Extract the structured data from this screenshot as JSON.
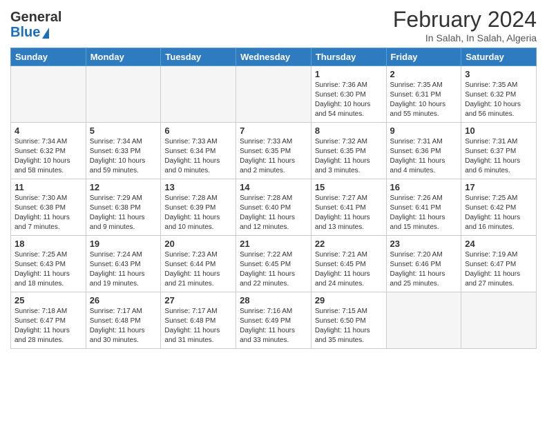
{
  "header": {
    "logo_text_general": "General",
    "logo_text_blue": "Blue",
    "month_title": "February 2024",
    "subtitle": "In Salah, In Salah, Algeria"
  },
  "days_of_week": [
    "Sunday",
    "Monday",
    "Tuesday",
    "Wednesday",
    "Thursday",
    "Friday",
    "Saturday"
  ],
  "weeks": [
    [
      {
        "day": "",
        "empty": true
      },
      {
        "day": "",
        "empty": true
      },
      {
        "day": "",
        "empty": true
      },
      {
        "day": "",
        "empty": true
      },
      {
        "day": "1",
        "sunrise": "7:36 AM",
        "sunset": "6:30 PM",
        "daylight": "10 hours and 54 minutes."
      },
      {
        "day": "2",
        "sunrise": "7:35 AM",
        "sunset": "6:31 PM",
        "daylight": "10 hours and 55 minutes."
      },
      {
        "day": "3",
        "sunrise": "7:35 AM",
        "sunset": "6:32 PM",
        "daylight": "10 hours and 56 minutes."
      }
    ],
    [
      {
        "day": "4",
        "sunrise": "7:34 AM",
        "sunset": "6:32 PM",
        "daylight": "10 hours and 58 minutes."
      },
      {
        "day": "5",
        "sunrise": "7:34 AM",
        "sunset": "6:33 PM",
        "daylight": "10 hours and 59 minutes."
      },
      {
        "day": "6",
        "sunrise": "7:33 AM",
        "sunset": "6:34 PM",
        "daylight": "11 hours and 0 minutes."
      },
      {
        "day": "7",
        "sunrise": "7:33 AM",
        "sunset": "6:35 PM",
        "daylight": "11 hours and 2 minutes."
      },
      {
        "day": "8",
        "sunrise": "7:32 AM",
        "sunset": "6:35 PM",
        "daylight": "11 hours and 3 minutes."
      },
      {
        "day": "9",
        "sunrise": "7:31 AM",
        "sunset": "6:36 PM",
        "daylight": "11 hours and 4 minutes."
      },
      {
        "day": "10",
        "sunrise": "7:31 AM",
        "sunset": "6:37 PM",
        "daylight": "11 hours and 6 minutes."
      }
    ],
    [
      {
        "day": "11",
        "sunrise": "7:30 AM",
        "sunset": "6:38 PM",
        "daylight": "11 hours and 7 minutes."
      },
      {
        "day": "12",
        "sunrise": "7:29 AM",
        "sunset": "6:38 PM",
        "daylight": "11 hours and 9 minutes."
      },
      {
        "day": "13",
        "sunrise": "7:28 AM",
        "sunset": "6:39 PM",
        "daylight": "11 hours and 10 minutes."
      },
      {
        "day": "14",
        "sunrise": "7:28 AM",
        "sunset": "6:40 PM",
        "daylight": "11 hours and 12 minutes."
      },
      {
        "day": "15",
        "sunrise": "7:27 AM",
        "sunset": "6:41 PM",
        "daylight": "11 hours and 13 minutes."
      },
      {
        "day": "16",
        "sunrise": "7:26 AM",
        "sunset": "6:41 PM",
        "daylight": "11 hours and 15 minutes."
      },
      {
        "day": "17",
        "sunrise": "7:25 AM",
        "sunset": "6:42 PM",
        "daylight": "11 hours and 16 minutes."
      }
    ],
    [
      {
        "day": "18",
        "sunrise": "7:25 AM",
        "sunset": "6:43 PM",
        "daylight": "11 hours and 18 minutes."
      },
      {
        "day": "19",
        "sunrise": "7:24 AM",
        "sunset": "6:43 PM",
        "daylight": "11 hours and 19 minutes."
      },
      {
        "day": "20",
        "sunrise": "7:23 AM",
        "sunset": "6:44 PM",
        "daylight": "11 hours and 21 minutes."
      },
      {
        "day": "21",
        "sunrise": "7:22 AM",
        "sunset": "6:45 PM",
        "daylight": "11 hours and 22 minutes."
      },
      {
        "day": "22",
        "sunrise": "7:21 AM",
        "sunset": "6:45 PM",
        "daylight": "11 hours and 24 minutes."
      },
      {
        "day": "23",
        "sunrise": "7:20 AM",
        "sunset": "6:46 PM",
        "daylight": "11 hours and 25 minutes."
      },
      {
        "day": "24",
        "sunrise": "7:19 AM",
        "sunset": "6:47 PM",
        "daylight": "11 hours and 27 minutes."
      }
    ],
    [
      {
        "day": "25",
        "sunrise": "7:18 AM",
        "sunset": "6:47 PM",
        "daylight": "11 hours and 28 minutes."
      },
      {
        "day": "26",
        "sunrise": "7:17 AM",
        "sunset": "6:48 PM",
        "daylight": "11 hours and 30 minutes."
      },
      {
        "day": "27",
        "sunrise": "7:17 AM",
        "sunset": "6:48 PM",
        "daylight": "11 hours and 31 minutes."
      },
      {
        "day": "28",
        "sunrise": "7:16 AM",
        "sunset": "6:49 PM",
        "daylight": "11 hours and 33 minutes."
      },
      {
        "day": "29",
        "sunrise": "7:15 AM",
        "sunset": "6:50 PM",
        "daylight": "11 hours and 35 minutes."
      },
      {
        "day": "",
        "empty": true
      },
      {
        "day": "",
        "empty": true
      }
    ]
  ]
}
